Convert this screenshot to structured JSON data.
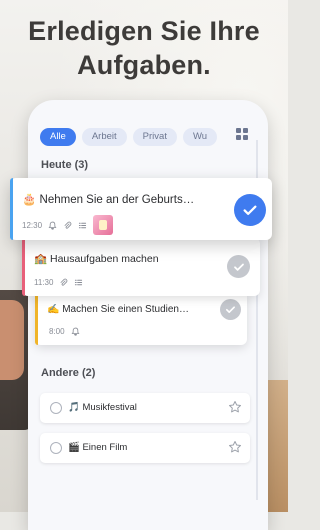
{
  "headline": {
    "line1": "Erledigen Sie Ihre",
    "line2": "Aufgaben."
  },
  "categories": [
    {
      "label": "Alle",
      "active": true
    },
    {
      "label": "Arbeit",
      "active": false
    },
    {
      "label": "Privat",
      "active": false
    },
    {
      "label": "Wu",
      "active": false
    }
  ],
  "today": {
    "header": "Heute (3)",
    "tasks": [
      {
        "title": "🎂 Nehmen Sie an der Geburts…",
        "time": "12:30",
        "accent": "#4aa3f0",
        "done": true
      },
      {
        "title": "🏫 Hausaufgaben machen",
        "time": "11:30",
        "accent": "#e8607a",
        "done": false
      },
      {
        "title": "✍️ Machen Sie einen Studien…",
        "time": "8:00",
        "accent": "#f0b429",
        "done": false
      }
    ]
  },
  "other": {
    "header": "Andere (2)",
    "tasks": [
      {
        "title": "🎵 Musikfestival"
      },
      {
        "title": "🎬 Einen Film"
      }
    ]
  },
  "colors": {
    "primary": "#3f7bef",
    "muted_check": "#b9bcc3"
  }
}
